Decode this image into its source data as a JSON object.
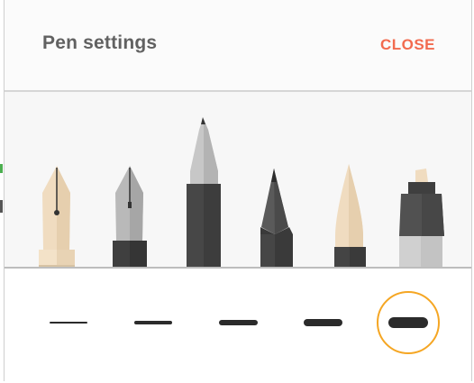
{
  "dialog": {
    "title": "Pen settings",
    "close_label": "CLOSE"
  },
  "colors": {
    "accent_close": "#f26b4f",
    "selected_ring": "#f5a623",
    "stroke": "#2b2b2b"
  },
  "pen_types": [
    {
      "name": "fountain-pen"
    },
    {
      "name": "calligraphy-pen"
    },
    {
      "name": "ballpoint-pen"
    },
    {
      "name": "pencil"
    },
    {
      "name": "brush"
    },
    {
      "name": "marker"
    }
  ],
  "stroke_sizes": {
    "options": [
      1,
      2,
      3,
      4,
      5
    ],
    "selected": 5
  }
}
